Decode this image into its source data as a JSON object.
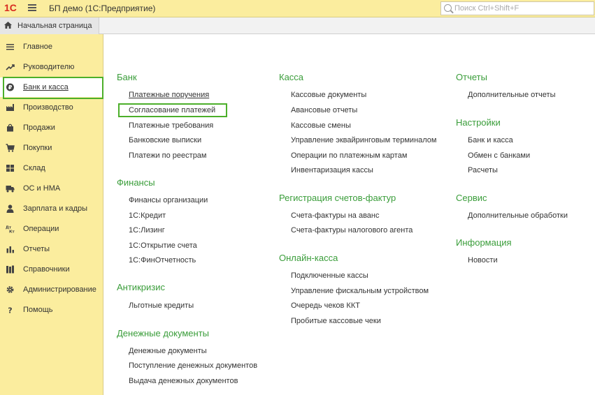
{
  "header": {
    "logo": "1С",
    "app_title": "БП демо  (1С:Предприятие)",
    "search_placeholder": "Поиск Ctrl+Shift+F"
  },
  "tabs": {
    "home_label": "Начальная страница"
  },
  "sidebar": {
    "items": [
      {
        "label": "Главное",
        "icon": "hamburger-icon"
      },
      {
        "label": "Руководителю",
        "icon": "trend-icon"
      },
      {
        "label": "Банк и касса",
        "icon": "ruble-coin-icon",
        "active": true
      },
      {
        "label": "Производство",
        "icon": "factory-icon"
      },
      {
        "label": "Продажи",
        "icon": "bag-icon"
      },
      {
        "label": "Покупки",
        "icon": "cart-icon"
      },
      {
        "label": "Склад",
        "icon": "grid-icon"
      },
      {
        "label": "ОС и НМА",
        "icon": "truck-icon"
      },
      {
        "label": "Зарплата и кадры",
        "icon": "person-icon"
      },
      {
        "label": "Операции",
        "icon": "dt-kt-icon"
      },
      {
        "label": "Отчеты",
        "icon": "bar-chart-icon"
      },
      {
        "label": "Справочники",
        "icon": "books-icon"
      },
      {
        "label": "Администрирование",
        "icon": "gear-icon"
      },
      {
        "label": "Помощь",
        "icon": "question-icon"
      }
    ]
  },
  "sections": {
    "bank": {
      "title": "Банк",
      "links": [
        "Платежные поручения",
        "Согласование платежей",
        "Платежные требования",
        "Банковские выписки",
        "Платежи по реестрам"
      ]
    },
    "finance": {
      "title": "Финансы",
      "links": [
        "Финансы организации",
        "1С:Кредит",
        "1С:Лизинг",
        "1С:Открытие счета",
        "1С:ФинОтчетность"
      ]
    },
    "anticrisis": {
      "title": "Антикризис",
      "links": [
        "Льготные кредиты"
      ]
    },
    "money_docs": {
      "title": "Денежные документы",
      "links": [
        "Денежные документы",
        "Поступление денежных документов",
        "Выдача денежных документов"
      ]
    },
    "cash": {
      "title": "Касса",
      "links": [
        "Кассовые документы",
        "Авансовые отчеты",
        "Кассовые смены",
        "Управление эквайринговым терминалом",
        "Операции по платежным картам",
        "Инвентаризация кассы"
      ]
    },
    "invoices": {
      "title": "Регистрация счетов-фактур",
      "links": [
        "Счета-фактуры на аванс",
        "Счета-фактуры налогового агента"
      ]
    },
    "online_cash": {
      "title": "Онлайн-касса",
      "links": [
        "Подключенные кассы",
        "Управление фискальным устройством",
        "Очередь чеков ККТ",
        "Пробитые кассовые чеки"
      ]
    },
    "reports": {
      "title": "Отчеты",
      "links": [
        "Дополнительные отчеты"
      ]
    },
    "settings": {
      "title": "Настройки",
      "links": [
        "Банк и касса",
        "Обмен с банками",
        "Расчеты"
      ]
    },
    "service": {
      "title": "Сервис",
      "links": [
        "Дополнительные обработки"
      ]
    },
    "info": {
      "title": "Информация",
      "links": [
        "Новости"
      ]
    }
  },
  "colors": {
    "sidebar_bg": "#fbed9e",
    "section_title": "#3a9d3a",
    "highlight": "#4caf2a",
    "logo_red": "#d82a1f"
  }
}
